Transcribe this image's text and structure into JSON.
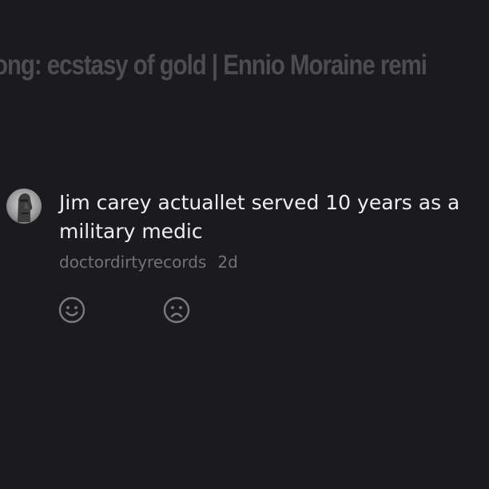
{
  "banner": {
    "song_text": "ong: ecstasy of gold | Ennio Moraine remi"
  },
  "comment": {
    "text": "Jim carey actuallet served 10 years as a military medic",
    "author": "doctordirtyrecords",
    "age": "2d",
    "avatar_icon": "moai-avatar-icon"
  },
  "reactions": {
    "like_icon": "smiley-face-icon",
    "dislike_icon": "frowning-face-icon"
  },
  "colors": {
    "background": "#1b1b1f",
    "comment_text": "#eeeeee",
    "meta_text": "#727378",
    "banner_text": "#4c4d52",
    "icon_stroke": "#7a7b80"
  }
}
